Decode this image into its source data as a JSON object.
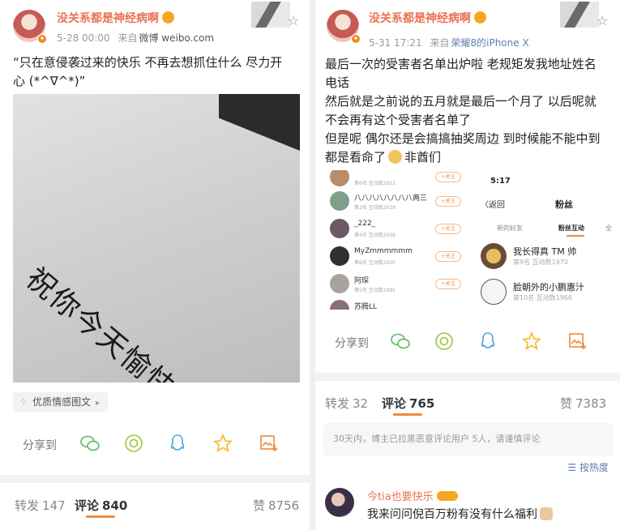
{
  "left_post": {
    "username": "没关系都是神经病啊",
    "time": "5-28 00:00",
    "source_prefix": "来自",
    "source": "微博 weibo.com",
    "text_line1": "“只在意侵袭过来的快乐 不再去想抓住什么 尽力开",
    "text_line2": "心 (*^∇^*)”",
    "photo_text": "祝你今天愉快。",
    "tag_label": "优质情感图文",
    "share_label": "分享到",
    "stats": {
      "repost_label": "转发",
      "repost_count": "147",
      "comment_label": "评论",
      "comment_count": "840",
      "like_label": "赞",
      "like_count": "8756"
    }
  },
  "right_post": {
    "username": "没关系都是神经病啊",
    "time": "5-31 17:21",
    "source_prefix": "来自",
    "source": "荣耀8的iPhone X",
    "lines": [
      "最后一次的受害者名单出炉啦 老规矩发我地址姓名",
      "电话",
      "然后就是之前说的五月就是最后一个月了 以后呢就",
      "不会再有这个受害者名单了",
      "但是呢 偶尔还是会搞搞抽奖周边 到时候能不能中到",
      "都是看命了"
    ],
    "line6_suffix": "非酋们",
    "screenshot": {
      "rows": [
        {
          "name": "",
          "sub": "第6名 互动数2022",
          "btn": "+关注"
        },
        {
          "name": "八八八八八八八八两三",
          "sub": "第2名 互动数2028",
          "btn": "+关注"
        },
        {
          "name": "_222_",
          "sub": "第4名 互动数2006",
          "btn": "+关注"
        },
        {
          "name": "MyZmmmmmm",
          "sub": "第6名 互动数2000",
          "btn": "+关注"
        },
        {
          "name": "阿琛",
          "sub": "第5名 互动数1995",
          "btn": "+关注"
        },
        {
          "name": "苏腾LL",
          "sub": "",
          "btn": ""
        }
      ],
      "time": "5:17",
      "back": "〈返回",
      "title": "粉丝",
      "tabs": [
        "新的好友",
        "粉丝互动",
        "全"
      ],
      "fans": [
        {
          "name": "我长得真 TM 帅",
          "sub": "第9名 互动数1970"
        },
        {
          "name": "脸朝外的小鹏惠汁",
          "sub": "第10名 互动数1966"
        }
      ]
    },
    "share_label": "分享到",
    "stats": {
      "repost_label": "转发",
      "repost_count": "32",
      "comment_label": "评论",
      "comment_count": "765",
      "like_label": "赞",
      "like_count": "7383"
    },
    "notice": "30天内，博主已拉黑恶意评论用户 5人，请谨慎评论",
    "sort_label": "按热度",
    "comment": {
      "username": "今tia也要快乐",
      "text": "我来问问倪百万粉有没有什么福利"
    }
  },
  "colors": {
    "username": "#eb7350",
    "accent": "#f08a3a",
    "link": "#5d7eb0"
  }
}
